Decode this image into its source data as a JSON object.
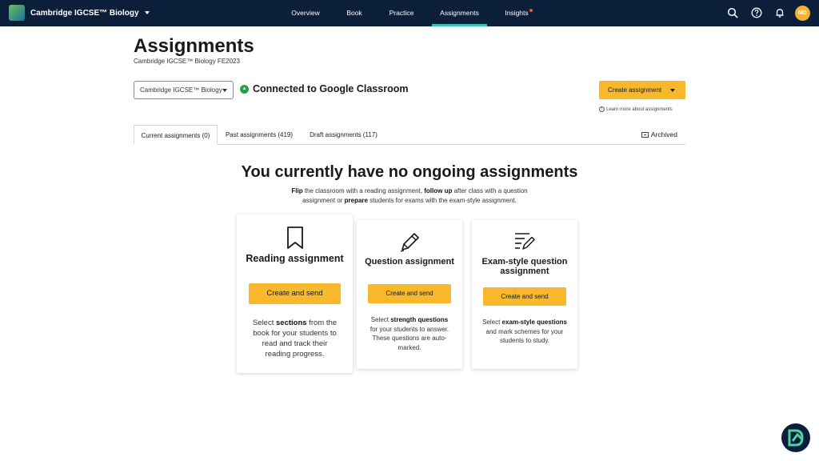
{
  "app": {
    "title": "Cambridge IGCSE™ Biology"
  },
  "nav": {
    "items": [
      "Overview",
      "Book",
      "Practice",
      "Assignments",
      "Insights"
    ],
    "active": "Assignments"
  },
  "user": {
    "initials": "MD"
  },
  "header": {
    "title": "Assignments",
    "subtitle": "Cambridge IGCSE™ Biology FE2023"
  },
  "toolbar": {
    "course_select": "Cambridge IGCSE™ Biology",
    "classroom_status": "Connected to Google Classroom",
    "create_label": "Create assignment",
    "learn_more": "Learn more about assignments"
  },
  "tabs": [
    {
      "label": "Current assignments (0)"
    },
    {
      "label": "Past assignments (419)"
    },
    {
      "label": "Draft assignments (117)"
    }
  ],
  "archived_label": "Archived",
  "empty_state": {
    "title": "You currently have no ongoing assignments",
    "intro_1": "Flip",
    "intro_2": " the classroom with a reading assignment, ",
    "intro_3": "follow up",
    "intro_4": " after class with a question assignment or ",
    "intro_5": "prepare",
    "intro_6": " students for exams with the exam-style assignment."
  },
  "cards": [
    {
      "title": "Reading assignment",
      "button": "Create and send",
      "desc_pre": "Select ",
      "desc_bold": "sections",
      "desc_post": " from the book for your students to read and track their reading progress."
    },
    {
      "title": "Question assignment",
      "button": "Create and send",
      "desc_pre": "Select ",
      "desc_bold": "strength questions",
      "desc_post": " for your students to answer. These questions are auto-marked."
    },
    {
      "title": "Exam-style question assignment",
      "button": "Create and send",
      "desc_pre": "Select ",
      "desc_bold": "exam-style questions",
      "desc_post": " and mark schemes for your students to study."
    }
  ],
  "colors": {
    "topbar": "#0b1f3a",
    "accent_tab": "#33c4b6",
    "button": "#f7b82b",
    "classroom_badge": "#2a9d47"
  },
  "icons": [
    "search-icon",
    "help-icon",
    "bell-icon",
    "bookmark-icon",
    "pencil-icon",
    "exam-lines-pencil-icon",
    "archive-icon",
    "info-icon",
    "chat-assistant-icon"
  ]
}
